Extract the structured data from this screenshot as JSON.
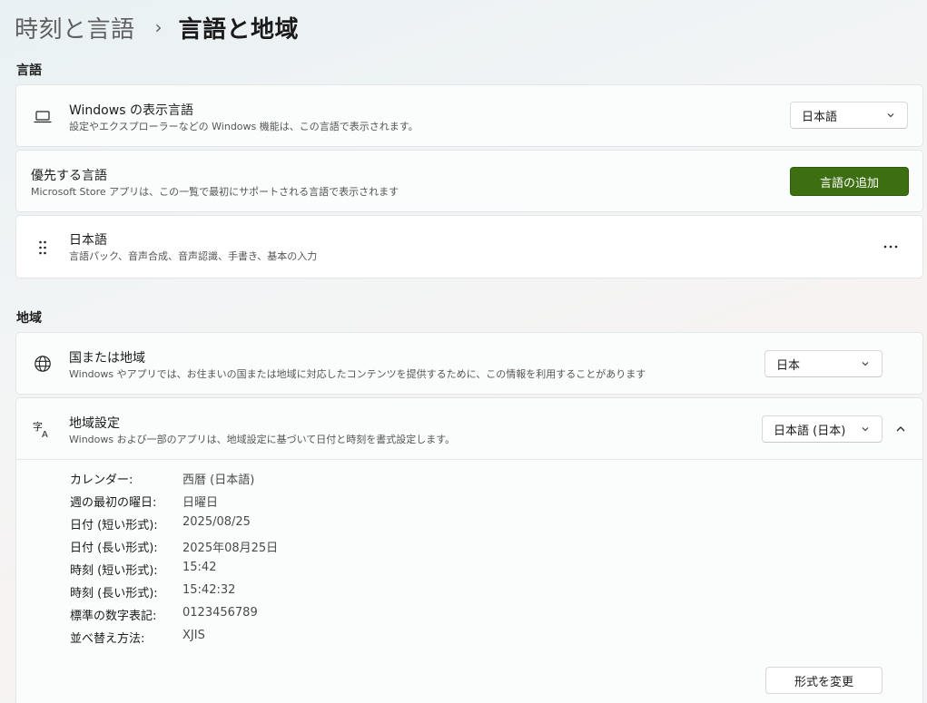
{
  "breadcrumb": {
    "parent": "時刻と言語",
    "separator": "›",
    "current": "言語と地域"
  },
  "sections": {
    "language": "言語",
    "region": "地域"
  },
  "display_language": {
    "icon": "laptop-icon",
    "title": "Windows の表示言語",
    "description": "設定やエクスプローラーなどの Windows 機能は、この言語で表示されます。",
    "value": "日本語"
  },
  "preferred_languages": {
    "title": "優先する言語",
    "description": "Microsoft Store アプリは、この一覧で最初にサポートされる言語で表示されます",
    "add_button": "言語の追加"
  },
  "language_item": {
    "icon": "drag-handle-icon",
    "name": "日本語",
    "features": "言語パック、音声合成、音声認識、手書き、基本の入力",
    "more": "more-options-icon"
  },
  "country": {
    "icon": "globe-icon",
    "title": "国または地域",
    "description": "Windows やアプリでは、お住まいの国または地域に対応したコンテンツを提供するために、この情報を利用することがあります",
    "value": "日本"
  },
  "regional_format": {
    "icon": "language-translate-icon",
    "title": "地域設定",
    "description": "Windows および一部のアプリは、地域設定に基づいて日付と時刻を書式設定します。",
    "value": "日本語 (日本)",
    "details": [
      {
        "label": "カレンダー:",
        "value": "西暦 (日本語)"
      },
      {
        "label": "週の最初の曜日:",
        "value": "日曜日"
      },
      {
        "label": "日付 (短い形式):",
        "value": "2025/08/25"
      },
      {
        "label": "日付 (長い形式):",
        "value": "2025年08月25日"
      },
      {
        "label": "時刻 (短い形式):",
        "value": "15:42"
      },
      {
        "label": "時刻 (長い形式):",
        "value": "15:42:32"
      },
      {
        "label": "標準の数字表記:",
        "value": "0123456789"
      },
      {
        "label": "並べ替え方法:",
        "value": "XJIS"
      }
    ],
    "change_button": "形式を変更"
  },
  "colors": {
    "accent": "#3d6e12"
  }
}
